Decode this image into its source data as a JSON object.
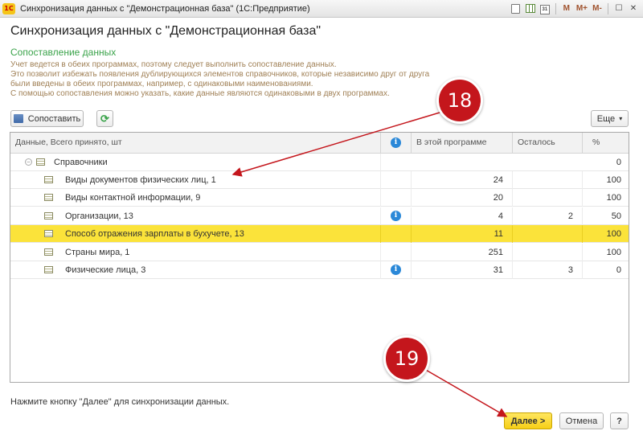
{
  "window": {
    "logo": "1С",
    "title": "Синхронизация данных с \"Демонстрационная база\"  (1С:Предприятие)",
    "tools": [
      "M",
      "M+",
      "M-"
    ]
  },
  "page": {
    "title": "Синхронизация данных с \"Демонстрационная база\"",
    "section_title": "Сопоставление данных",
    "description": [
      "Учет ведется в обеих программах, поэтому следует выполнить сопоставление данных.",
      "Это позволит избежать появления дублирующихся элементов справочников, которые независимо друг от друга",
      "были введены в обеих программах, например, с одинаковыми наименованиями.",
      "С помощью сопоставления можно указать, какие данные являются одинаковыми в двух программах."
    ]
  },
  "toolbar": {
    "compare_label": "Сопоставить",
    "more_label": "Еще"
  },
  "table": {
    "headers": {
      "name": "Данные, Всего принято, шт",
      "in_program": "В этой программе",
      "remaining": "Осталось",
      "percent": "%"
    },
    "group": {
      "name": "Справочники",
      "percent": "0"
    },
    "rows": [
      {
        "name": "Виды документов физических лиц, 1",
        "info": false,
        "in_program": "24",
        "remaining": "",
        "percent": "100",
        "selected": false
      },
      {
        "name": "Виды контактной информации, 9",
        "info": false,
        "in_program": "20",
        "remaining": "",
        "percent": "100",
        "selected": false
      },
      {
        "name": "Организации, 13",
        "info": true,
        "in_program": "4",
        "remaining": "2",
        "percent": "50",
        "selected": false
      },
      {
        "name": "Способ отражения зарплаты в бухучете, 13",
        "info": false,
        "in_program": "11",
        "remaining": "",
        "percent": "100",
        "selected": true
      },
      {
        "name": "Страны мира, 1",
        "info": false,
        "in_program": "251",
        "remaining": "",
        "percent": "100",
        "selected": false
      },
      {
        "name": "Физические лица, 3",
        "info": true,
        "in_program": "31",
        "remaining": "3",
        "percent": "0",
        "selected": false
      }
    ]
  },
  "footer": {
    "hint": "Нажмите кнопку \"Далее\" для синхронизации данных.",
    "next_label": "Далее >",
    "cancel_label": "Отмена",
    "help_label": "?"
  },
  "callouts": {
    "first": "18",
    "second": "19"
  },
  "colors": {
    "accent_green": "#3aa34a",
    "selection_yellow": "#fbe33a",
    "callout_red": "#c4161c",
    "info_blue": "#2a88d8"
  }
}
